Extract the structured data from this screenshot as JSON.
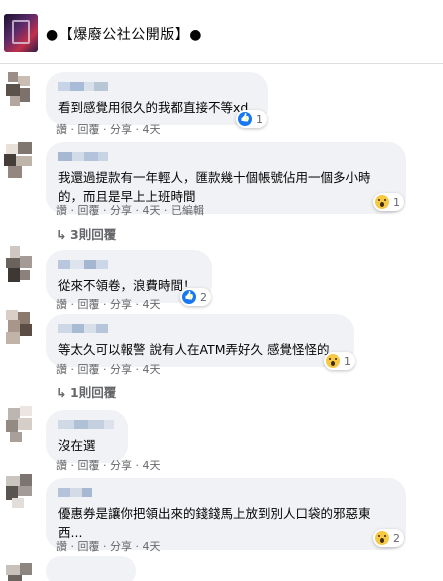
{
  "group": {
    "title": "●【爆廢公社公開版】●"
  },
  "colors": {
    "bubble": "#f0f2f5",
    "meta_text": "#65676b",
    "like": "#1877f2",
    "wow": "#f7c843"
  },
  "comments": [
    {
      "text": "看到感覺用很久的我都直接不等xd",
      "actions": [
        "讚",
        "回覆",
        "分享",
        "4天"
      ],
      "reaction": {
        "icon": "like-icon",
        "count": "1"
      }
    },
    {
      "text": "我還過提款有一年輕人，匯款幾十個帳號佔用一個多小時的，而且是早上上班時間",
      "actions": [
        "讚",
        "回覆",
        "分享",
        "4天",
        "已編輯"
      ],
      "reaction": {
        "icon": "wow-icon",
        "count": "1"
      },
      "replies": "3則回覆"
    },
    {
      "text": "從來不領卷，浪費時間！",
      "actions": [
        "讚",
        "回覆",
        "分享",
        "4天"
      ],
      "reaction": {
        "icon": "like-icon",
        "count": "2"
      }
    },
    {
      "text": "等太久可以報警 說有人在ATM弄好久 感覺怪怪的",
      "actions": [
        "讚",
        "回覆",
        "分享",
        "4天"
      ],
      "reaction": {
        "icon": "wow-icon",
        "count": "1"
      },
      "replies": "1則回覆"
    },
    {
      "text": "沒在選",
      "actions": [
        "讚",
        "回覆",
        "分享",
        "4天"
      ]
    },
    {
      "text": "優惠券是讓你把領出來的錢錢馬上放到別人口袋的邪惡東西...",
      "actions": [
        "讚",
        "回覆",
        "分享",
        "4天"
      ],
      "reaction": {
        "icon": "wow-icon",
        "count": "2"
      }
    }
  ]
}
